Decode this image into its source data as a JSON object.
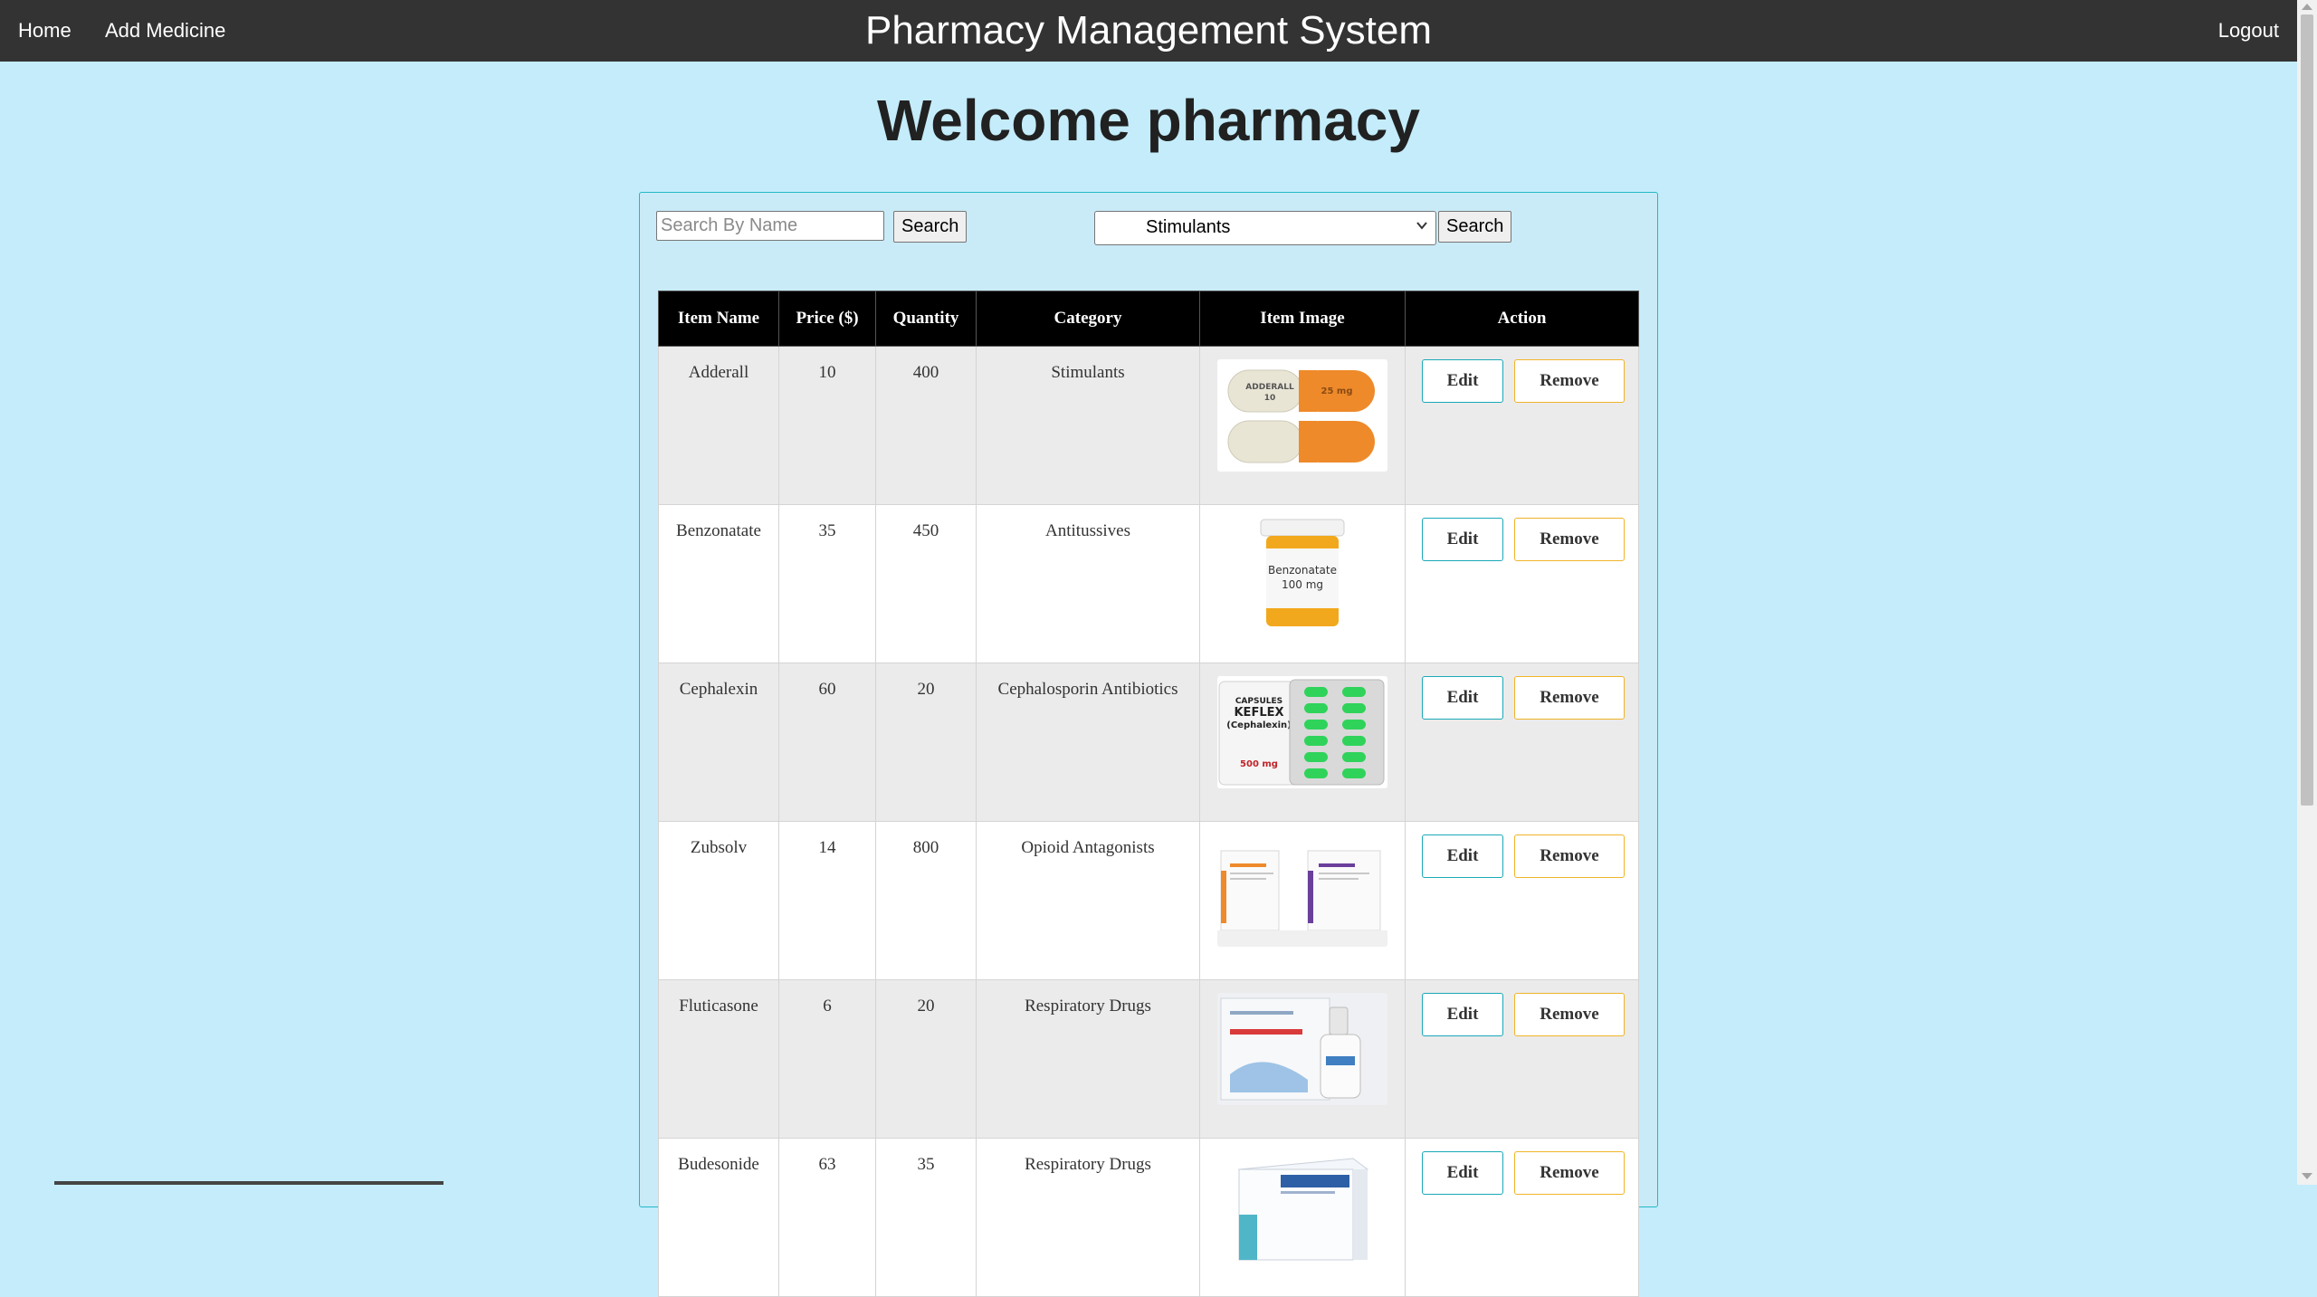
{
  "nav": {
    "home": "Home",
    "add_medicine": "Add Medicine",
    "title": "Pharmacy Management System",
    "logout": "Logout"
  },
  "welcome": "Welcome pharmacy",
  "search": {
    "placeholder": "Search By Name",
    "button": "Search",
    "category_selected": "Stimulants",
    "category_button": "Search"
  },
  "table": {
    "headers": [
      "Item Name",
      "Price ($)",
      "Quantity",
      "Category",
      "Item Image",
      "Action"
    ],
    "edit_label": "Edit",
    "remove_label": "Remove",
    "rows": [
      {
        "name": "Adderall",
        "price": "10",
        "quantity": "400",
        "category": "Stimulants"
      },
      {
        "name": "Benzonatate",
        "price": "35",
        "quantity": "450",
        "category": "Antitussives"
      },
      {
        "name": "Cephalexin",
        "price": "60",
        "quantity": "20",
        "category": "Cephalosporin Antibiotics"
      },
      {
        "name": "Zubsolv",
        "price": "14",
        "quantity": "800",
        "category": "Opioid Antagonists"
      },
      {
        "name": "Fluticasone",
        "price": "6",
        "quantity": "20",
        "category": "Respiratory Drugs"
      },
      {
        "name": "Budesonide",
        "price": "63",
        "quantity": "35",
        "category": "Respiratory Drugs"
      }
    ]
  },
  "image_text": {
    "adderall_cap1": "ADDERALL",
    "adderall_cap2": "10",
    "adderall_dose": "25 mg",
    "benzonatate_label1": "Benzonatate",
    "benzonatate_label2": "100 mg",
    "keflex_line1": "CAPSULES",
    "keflex_line2": "KEFLEX",
    "keflex_line3": "(Cephalexin)",
    "keflex_dose": "500 mg"
  }
}
